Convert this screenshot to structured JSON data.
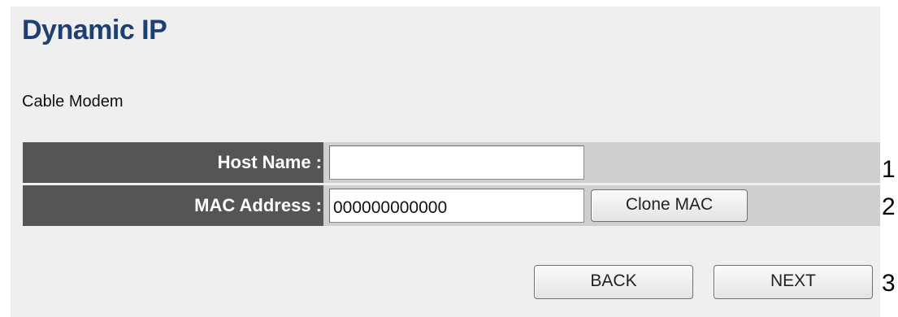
{
  "page": {
    "title": "Dynamic IP",
    "subtitle": "Cable Modem"
  },
  "form": {
    "host_name": {
      "label": "Host Name :",
      "value": ""
    },
    "mac_address": {
      "label": "MAC Address :",
      "value": "000000000000",
      "clone_button": "Clone MAC"
    }
  },
  "actions": {
    "back_label": "BACK",
    "next_label": "NEXT"
  },
  "callouts": [
    "1",
    "2",
    "3"
  ],
  "colors": {
    "title": "#1e3f73",
    "label_background": "#555555",
    "field_background": "#cfcfcf",
    "panel_background": "#efefef"
  }
}
